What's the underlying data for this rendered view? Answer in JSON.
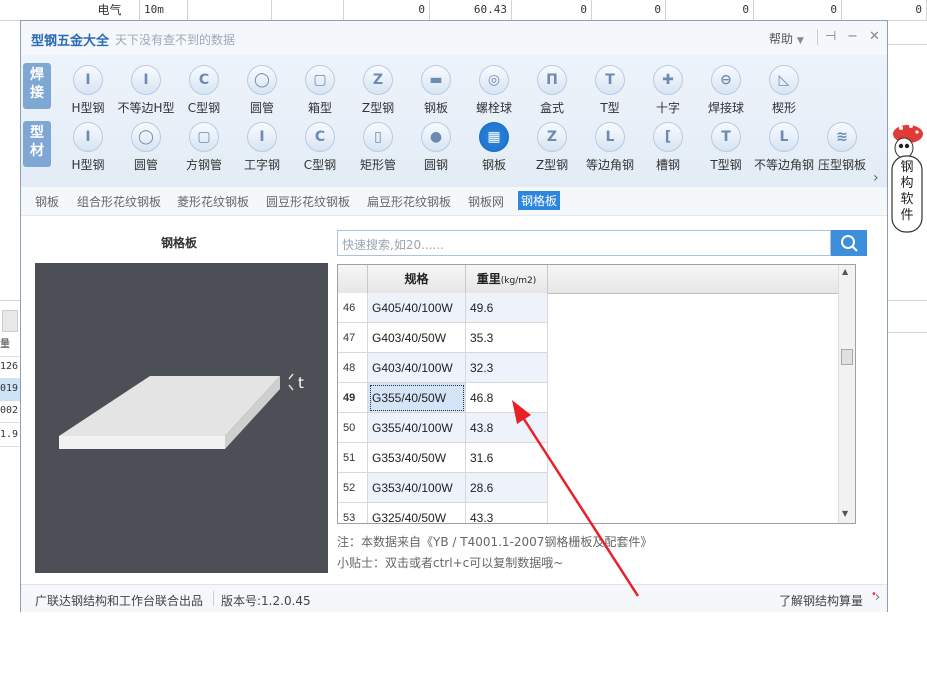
{
  "spreadsheet": {
    "top_row": [
      "电气",
      "10m",
      "0",
      "60.43",
      "0",
      "0",
      "0",
      "0",
      "0"
    ],
    "left_tab": "",
    "left_header": "量",
    "left_values": [
      "126",
      "019",
      "002",
      "1.9"
    ]
  },
  "window": {
    "title": "型钢五金大全",
    "subtitle": "天下没有查不到的数据",
    "help_label": "帮助"
  },
  "ribbon": {
    "row1_tag": "焊接",
    "row2_tag": "型材",
    "row1": [
      {
        "label": "H型钢",
        "glyph": "I"
      },
      {
        "label": "不等边H型",
        "glyph": "I"
      },
      {
        "label": "C型钢",
        "glyph": "C"
      },
      {
        "label": "圆管",
        "glyph": "◯"
      },
      {
        "label": "箱型",
        "glyph": "▢"
      },
      {
        "label": "Z型钢",
        "glyph": "Z"
      },
      {
        "label": "钢板",
        "glyph": "▬"
      },
      {
        "label": "螺栓球",
        "glyph": "◎"
      },
      {
        "label": "盒式",
        "glyph": "П"
      },
      {
        "label": "T型",
        "glyph": "T"
      },
      {
        "label": "十字",
        "glyph": "✚"
      },
      {
        "label": "焊接球",
        "glyph": "⊖"
      },
      {
        "label": "楔形",
        "glyph": "◺"
      }
    ],
    "row2": [
      {
        "label": "H型钢",
        "glyph": "I"
      },
      {
        "label": "圆管",
        "glyph": "◯"
      },
      {
        "label": "方钢管",
        "glyph": "▢"
      },
      {
        "label": "工字钢",
        "glyph": "I"
      },
      {
        "label": "C型钢",
        "glyph": "C"
      },
      {
        "label": "矩形管",
        "glyph": "▯"
      },
      {
        "label": "圆钢",
        "glyph": "●"
      },
      {
        "label": "钢板",
        "glyph": "▦"
      },
      {
        "label": "Z型钢",
        "glyph": "Z"
      },
      {
        "label": "等边角钢",
        "glyph": "L"
      },
      {
        "label": "槽钢",
        "glyph": "[",
        "note": ""
      },
      {
        "label": "T型钢",
        "glyph": "T"
      },
      {
        "label": "不等边角钢",
        "glyph": "L"
      },
      {
        "label": "压型钢板",
        "glyph": "≋"
      }
    ],
    "active_row2_index": 7
  },
  "subtabs": [
    "钢板",
    "组合形花纹钢板",
    "菱形花纹钢板",
    "圆豆形花纹钢板",
    "扁豆形花纹钢板",
    "钢板网",
    "钢格板"
  ],
  "subtabs_active": "钢格板",
  "panel": {
    "left_title": "钢格板",
    "thickness_label": "t",
    "search_placeholder": "快速搜索,如20......"
  },
  "table": {
    "headers": {
      "spec": "规格",
      "weight": "重里",
      "weight_unit": "(kg/m2)"
    },
    "rows": [
      {
        "n": "46",
        "spec": "G405/40/100W",
        "w": "49.6"
      },
      {
        "n": "47",
        "spec": "G403/40/50W",
        "w": "35.3"
      },
      {
        "n": "48",
        "spec": "G403/40/100W",
        "w": "32.3"
      },
      {
        "n": "49",
        "spec": "G355/40/50W",
        "w": "46.8"
      },
      {
        "n": "50",
        "spec": "G355/40/100W",
        "w": "43.8"
      },
      {
        "n": "51",
        "spec": "G353/40/50W",
        "w": "31.6"
      },
      {
        "n": "52",
        "spec": "G353/40/100W",
        "w": "28.6"
      },
      {
        "n": "53",
        "spec": "G325/40/50W",
        "w": "43.3"
      }
    ],
    "selected_row": "49"
  },
  "notes": {
    "source": "注：本数据来自《YB / T4001.1-2007钢格栅板及配套件》",
    "tip": "小贴士：双击或者ctrl+c可以复制数据哦~"
  },
  "status": {
    "left": "广联达钢结构和工作台联合出品",
    "version": "版本号:1.2.0.45",
    "right": "了解钢结构算量"
  },
  "mascot": {
    "text": "钢构软件"
  },
  "colors": {
    "accent": "#2f86de",
    "arrow": "#e8202a",
    "preview_bg": "#4c4f56"
  }
}
